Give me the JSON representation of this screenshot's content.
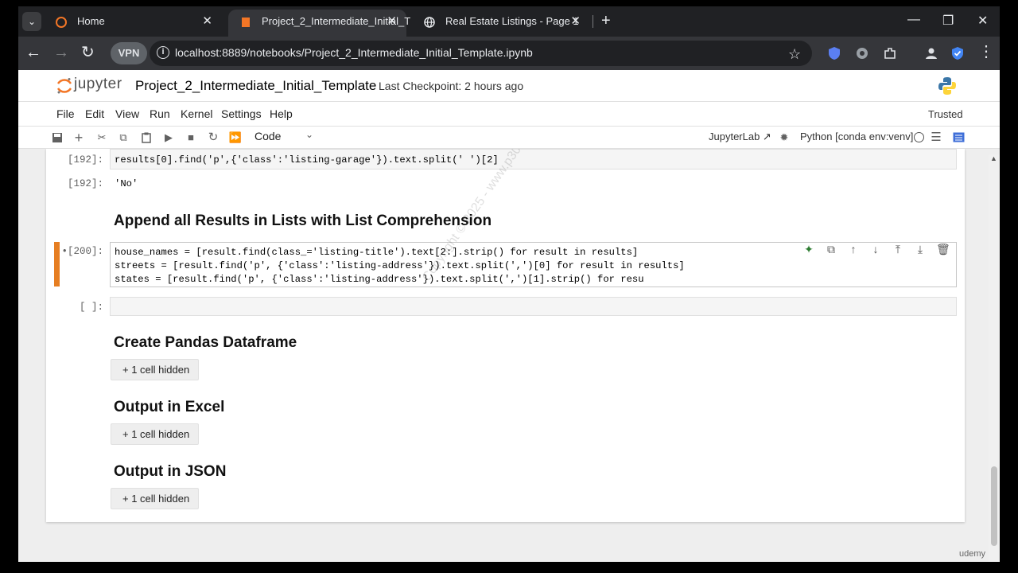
{
  "browser": {
    "tabs": [
      {
        "label": "Home"
      },
      {
        "label": "Project_2_Intermediate_Initial_T"
      },
      {
        "label": "Real Estate Listings - Page 1"
      }
    ],
    "vpn_label": "VPN",
    "url": "localhost:8889/notebooks/Project_2_Intermediate_Initial_Template.ipynb"
  },
  "jupyter": {
    "logo_text": "jupyter",
    "title": "Project_2_Intermediate_Initial_Template",
    "checkpoint": "Last Checkpoint: 2 hours ago",
    "menu": [
      "File",
      "Edit",
      "View",
      "Run",
      "Kernel",
      "Settings",
      "Help"
    ],
    "trusted": "Trusted",
    "cell_type": "Code",
    "jupyterlab_link": "JupyterLab ↗",
    "kernel": "Python [conda env:venv]"
  },
  "cells": {
    "c192_prompt": "[192]:",
    "c192_code": "results[0].find('p',{'class':'listing-garage'}).text.split(' ')[2]",
    "c192_out_prompt": "[192]:",
    "c192_output": "'No'",
    "heading_append": "Append all Results in Lists with List Comprehension",
    "c200_prompt": "•[200]:",
    "c200_lines": [
      "house_names = [result.find(class_='listing-title').text[2:].strip() for result in results]",
      "streets = [result.find('p', {'class':'listing-address'}).text.split(',')[0] for result in results]",
      "states = [result.find('p', {'class':'listing-address'}).text.split(',')[1].strip() for resu"
    ],
    "empty_prompt": "[ ]:",
    "heading_pandas": "Create Pandas Dataframe",
    "heading_excel": "Output in Excel",
    "heading_json": "Output in JSON",
    "hidden_label": "+ 1 cell hidden"
  },
  "overlay": {
    "watermark": "Copyright © 2025 - www.p30download.com",
    "udemy": "udemy"
  }
}
